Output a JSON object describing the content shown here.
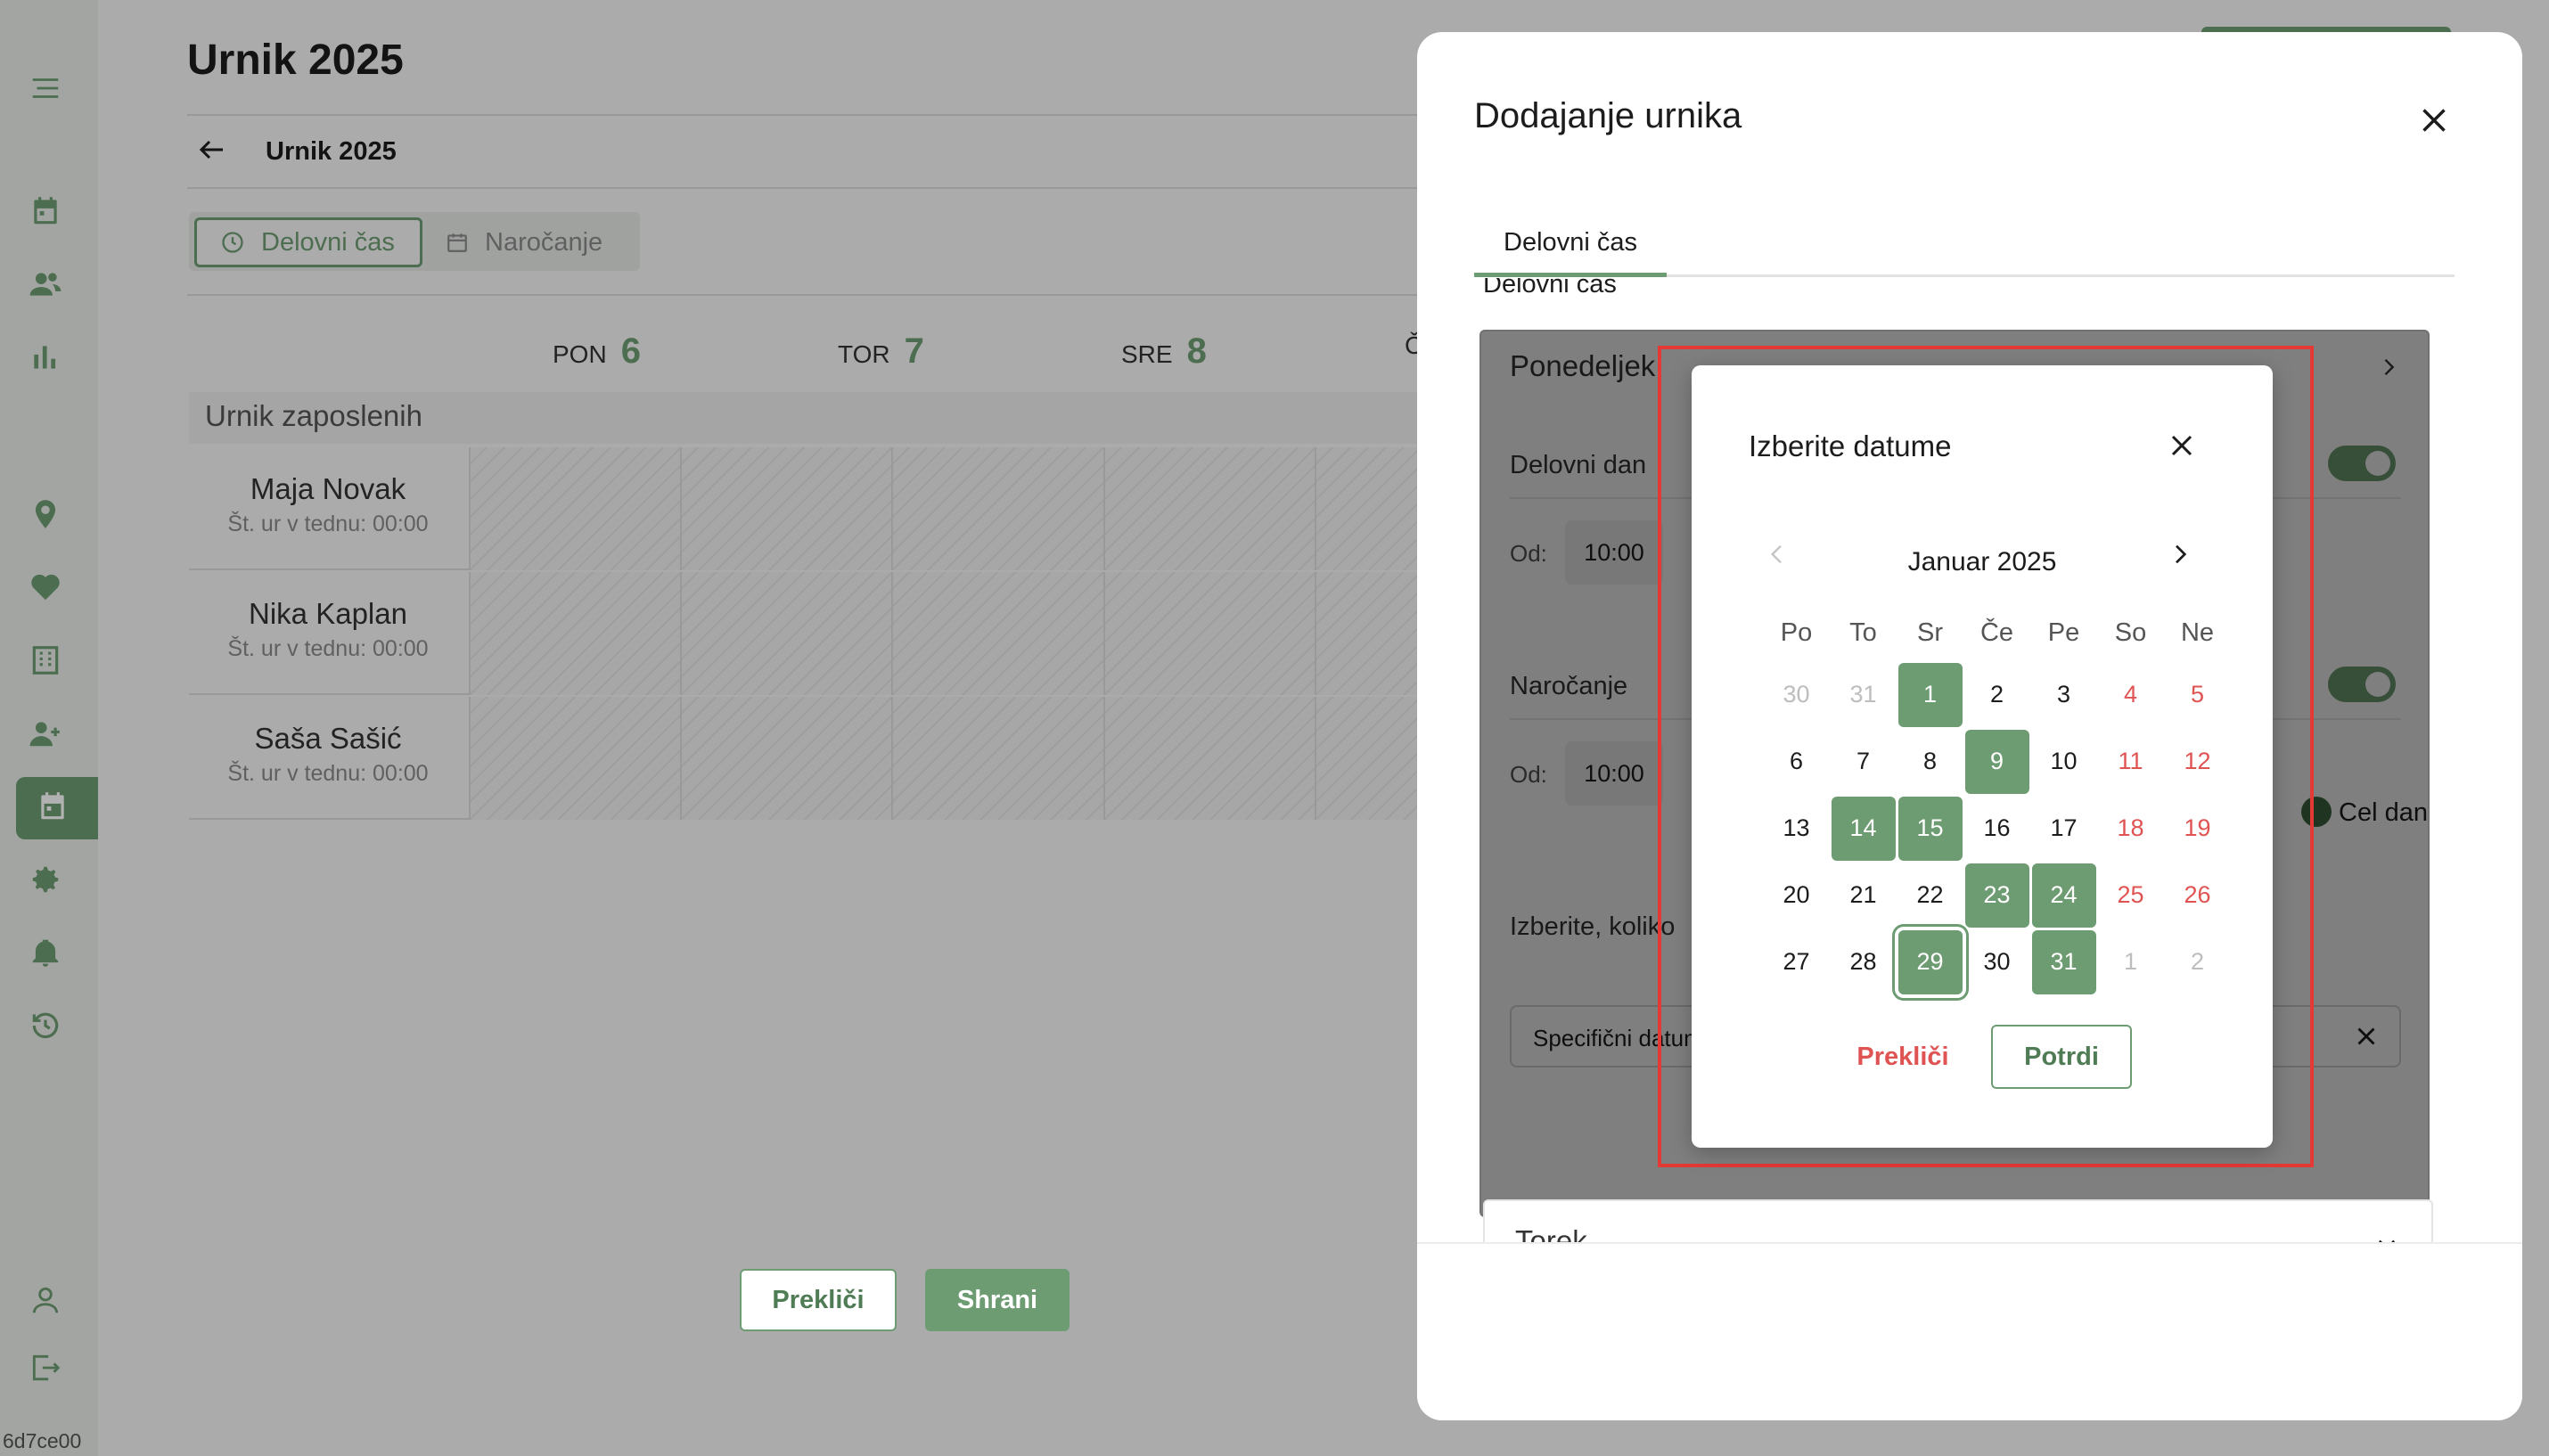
{
  "sidebar": {
    "build_id": "6d7ce00"
  },
  "page": {
    "title": "Urnik 2025",
    "breadcrumb": "Urnik 2025",
    "tabs": [
      {
        "label": "Delovni čas",
        "active": true
      },
      {
        "label": "Naročanje",
        "active": false
      }
    ],
    "days": [
      {
        "name": "PON",
        "num": "6"
      },
      {
        "name": "TOR",
        "num": "7"
      },
      {
        "name": "SRE",
        "num": "8"
      },
      {
        "name": "Č",
        "num": ""
      }
    ],
    "schedule_label": "Urnik zaposlenih",
    "employees": [
      {
        "name": "Maja Novak",
        "hours": "Št. ur v tednu: 00:00"
      },
      {
        "name": "Nika Kaplan",
        "hours": "Št. ur v tednu: 00:00"
      },
      {
        "name": "Saša Sašić",
        "hours": "Št. ur v tednu: 00:00"
      }
    ]
  },
  "drawer": {
    "title": "Dodajanje urnika",
    "tab": "Delovni čas",
    "section_heading": "Delovni čas",
    "card": {
      "day": "Ponedeljek",
      "working_day_label": "Delovni dan",
      "from_label": "Od:",
      "from_time": "10:00",
      "booking_label": "Naročanje",
      "booking_from_label": "Od:",
      "booking_from_time": "10:00",
      "full_day_label": "Cel dan",
      "select_label": "Izberite, koliko",
      "specific_dates_value": "Specifični datumi"
    },
    "next_day": "Torek",
    "cancel_label": "Prekliči",
    "save_label": "Shrani"
  },
  "date_picker": {
    "title": "Izberite datume",
    "month": "Januar 2025",
    "weekdays": [
      "Po",
      "To",
      "Sr",
      "Če",
      "Pe",
      "So",
      "Ne"
    ],
    "days": [
      {
        "d": "30",
        "muted": true
      },
      {
        "d": "31",
        "muted": true
      },
      {
        "d": "1",
        "selected": true
      },
      {
        "d": "2"
      },
      {
        "d": "3"
      },
      {
        "d": "4",
        "weekend": true
      },
      {
        "d": "5",
        "weekend": true
      },
      {
        "d": "6"
      },
      {
        "d": "7"
      },
      {
        "d": "8"
      },
      {
        "d": "9",
        "selected": true
      },
      {
        "d": "10"
      },
      {
        "d": "11",
        "weekend": true
      },
      {
        "d": "12",
        "weekend": true
      },
      {
        "d": "13"
      },
      {
        "d": "14",
        "selected": true
      },
      {
        "d": "15",
        "selected": true
      },
      {
        "d": "16"
      },
      {
        "d": "17"
      },
      {
        "d": "18",
        "weekend": true
      },
      {
        "d": "19",
        "weekend": true
      },
      {
        "d": "20"
      },
      {
        "d": "21"
      },
      {
        "d": "22"
      },
      {
        "d": "23",
        "selected": true
      },
      {
        "d": "24",
        "selected": true
      },
      {
        "d": "25",
        "weekend": true
      },
      {
        "d": "26",
        "weekend": true
      },
      {
        "d": "27"
      },
      {
        "d": "28"
      },
      {
        "d": "29",
        "selected": true,
        "focused": true
      },
      {
        "d": "30"
      },
      {
        "d": "31",
        "selected": true
      },
      {
        "d": "1",
        "muted": true,
        "weekend": true
      },
      {
        "d": "2",
        "muted": true,
        "weekend": true
      }
    ],
    "cancel_label": "Prekliči",
    "confirm_label": "Potrdi"
  },
  "colors": {
    "accent": "#6e9c72",
    "weekend": "#e05353",
    "highlight": "#e53935"
  }
}
